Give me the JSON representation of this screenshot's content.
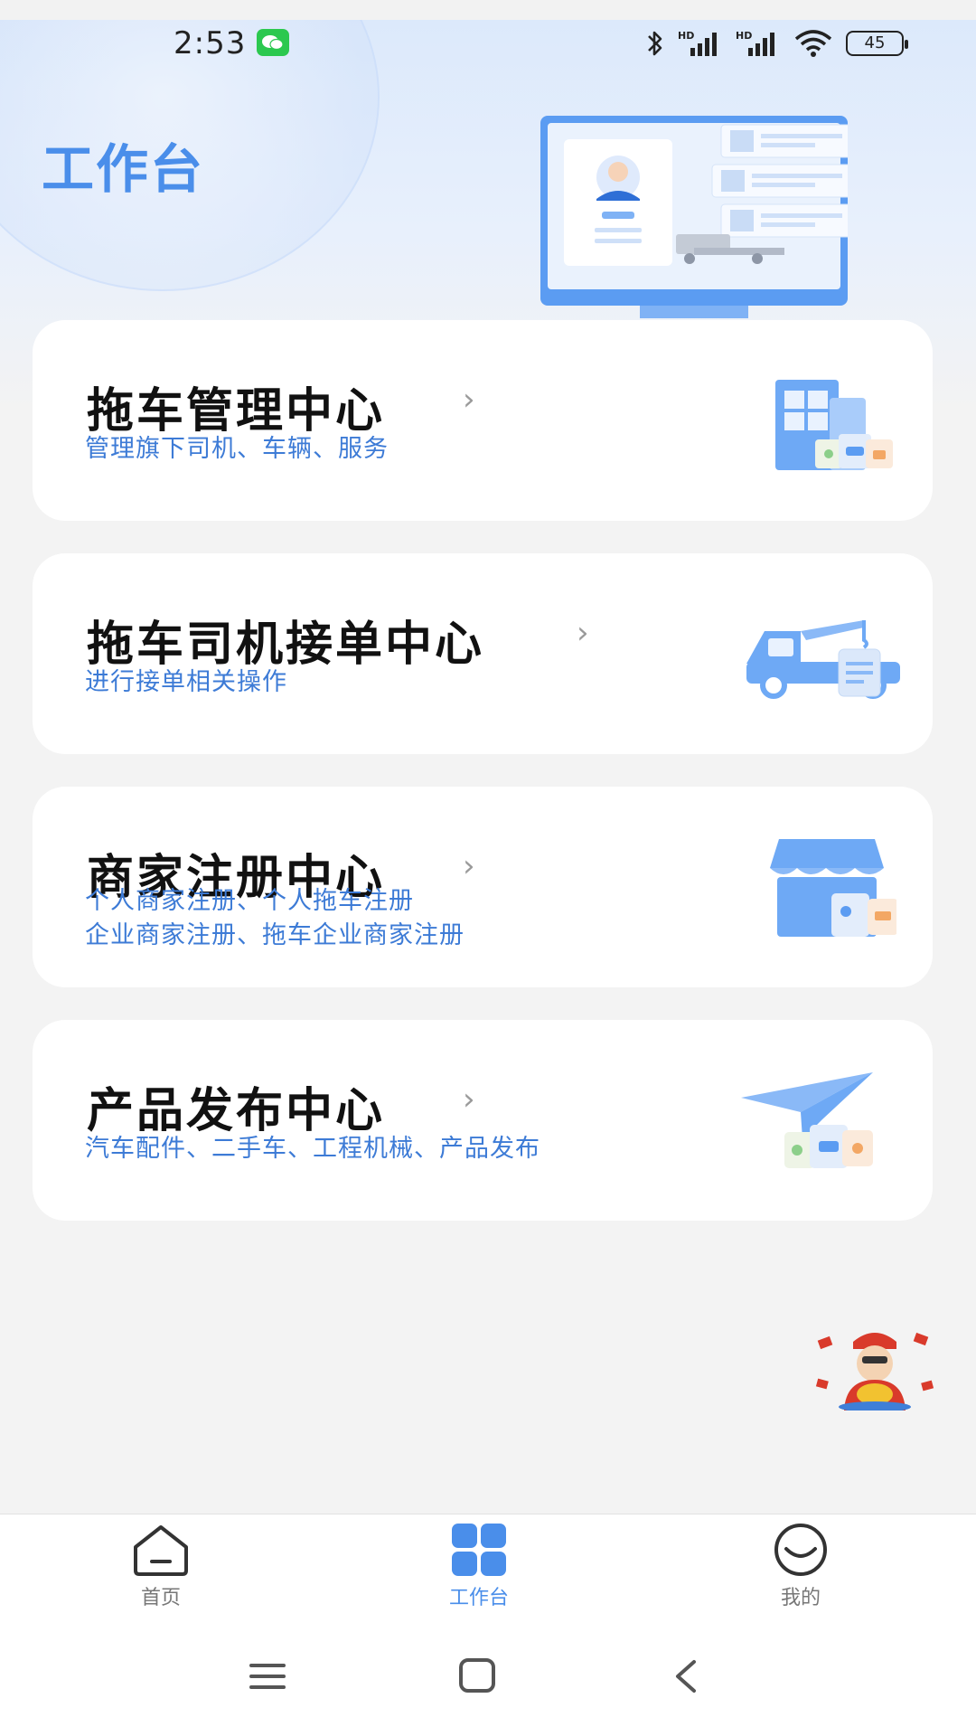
{
  "status_bar": {
    "time": "2:53",
    "battery": "45",
    "icons": [
      "wechat-icon",
      "bluetooth-icon",
      "hd-signal-icon",
      "hd-signal-icon",
      "wifi-icon",
      "battery-icon"
    ]
  },
  "header": {
    "title": "工作台"
  },
  "cards": [
    {
      "title": "拖车管理中心",
      "subtitle_lines": [
        "管理旗下司机、车辆、服务"
      ],
      "icon": "building-icon"
    },
    {
      "title": "拖车司机接单中心",
      "subtitle_lines": [
        "进行接单相关操作"
      ],
      "icon": "tow-truck-icon"
    },
    {
      "title": "商家注册中心",
      "subtitle_lines": [
        "个人商家注册、个人拖车注册",
        "企业商家注册、拖车企业商家注册"
      ],
      "icon": "shop-icon"
    },
    {
      "title": "产品发布中心",
      "subtitle_lines": [
        "汽车配件、二手车、工程机械、产品发布"
      ],
      "icon": "paper-plane-icon"
    }
  ],
  "tabbar": {
    "items": [
      {
        "label": "首页",
        "icon": "home-icon",
        "active": false
      },
      {
        "label": "工作台",
        "icon": "grid-icon",
        "active": true
      },
      {
        "label": "我的",
        "icon": "profile-smile-icon",
        "active": false
      }
    ]
  },
  "colors": {
    "accent": "#4a8eea",
    "subtitle": "#3d7bd6",
    "background": "#f3f3f3"
  }
}
